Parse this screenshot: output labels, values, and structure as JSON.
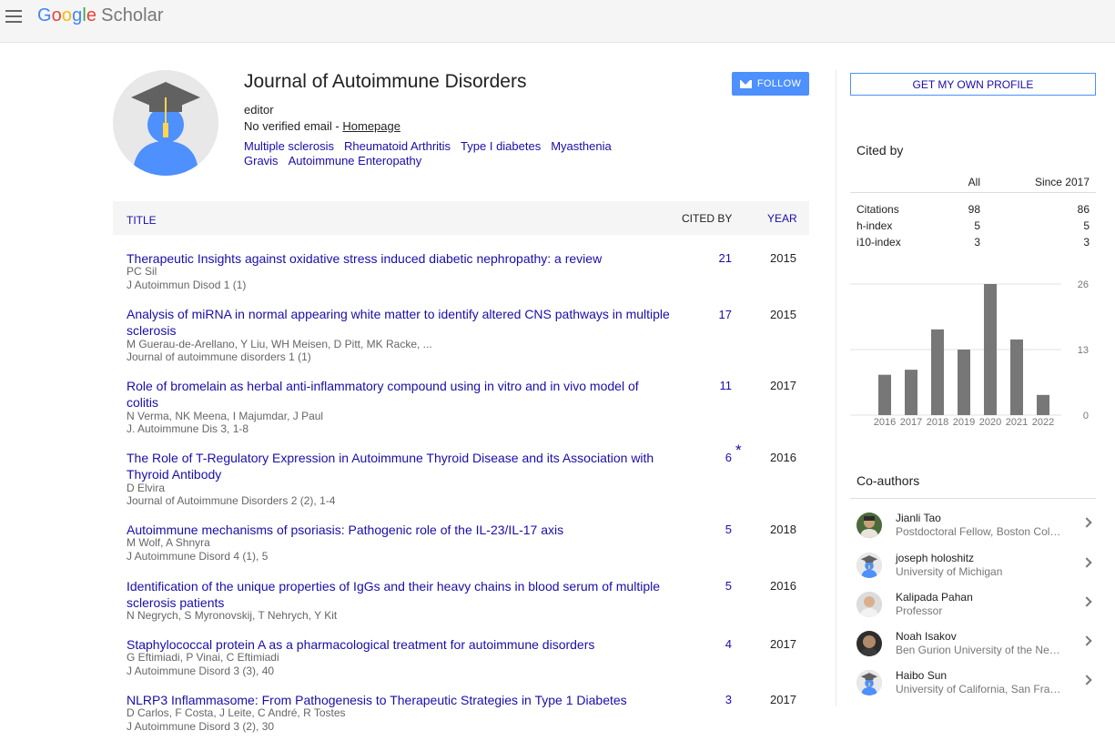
{
  "app": {
    "logo_google": [
      "G",
      "o",
      "o",
      "g",
      "l",
      "e"
    ],
    "logo_scholar": "Scholar"
  },
  "profile": {
    "name": "Journal of Autoimmune Disorders",
    "affiliation": "editor",
    "email_text": "No verified email - ",
    "homepage_label": "Homepage",
    "interests": [
      "Multiple sclerosis",
      "Rheumatoid Arthritis",
      "Type I diabetes",
      "Myasthenia Gravis",
      "Autoimmune Enteropathy"
    ],
    "follow_label": "FOLLOW"
  },
  "table": {
    "headers": {
      "title": "TITLE",
      "cited_by": "CITED BY",
      "year": "YEAR"
    },
    "articles": [
      {
        "title": "Therapeutic Insights against oxidative stress induced diabetic nephropathy: a review",
        "authors": "PC Sil",
        "venue": "J Autoimmun Disod 1 (1)",
        "cited": "21",
        "year": "2015"
      },
      {
        "title": "Analysis of miRNA in normal appearing white matter to identify altered CNS pathways in multiple sclerosis",
        "authors": "M Guerau-de-Arellano, Y Liu, WH Meisen, D Pitt, MK Racke, ...",
        "venue": "Journal of autoimmune disorders 1 (1)",
        "cited": "17",
        "year": "2015"
      },
      {
        "title": "Role of bromelain as herbal anti-inflammatory compound using in vitro and in vivo model of colitis",
        "authors": "N Verma, NK Meena, I Majumdar, J Paul",
        "venue": "J. Autoimmune Dis 3, 1-8",
        "cited": "11",
        "year": "2017"
      },
      {
        "title": "The Role of T-Regulatory Expression in Autoimmune Thyroid Disease and its Association with Thyroid Antibody",
        "authors": "D Elvira",
        "venue": "Journal of Autoimmune Disorders 2 (2), 1-4",
        "cited": "6",
        "star": "*",
        "year": "2016"
      },
      {
        "title": "Autoimmune mechanisms of psoriasis: Pathogenic role of the IL-23/IL-17 axis",
        "authors": "M Wolf, A Shnyra",
        "venue": "J Autoimmune Disord 4 (1), 5",
        "cited": "5",
        "year": "2018"
      },
      {
        "title": "Identification of the unique properties of IgGs and their heavy chains in blood serum of multiple sclerosis patients",
        "authors": "N Negrych, S Myronovskij, T Nehrych, Y Kit",
        "venue": "",
        "cited": "5",
        "year": "2016"
      },
      {
        "title": "Staphylococcal protein A as a pharmacological treatment for autoimmune disorders",
        "authors": "G Eftimiadi, P Vinai, C Eftimiadi",
        "venue": "J Autoimmune Disord 3 (3), 40",
        "cited": "4",
        "year": "2017"
      },
      {
        "title": "NLRP3 Inflammasome: From Pathogenesis to Therapeutic Strategies in Type 1 Diabetes",
        "authors": "D Carlos, F Costa, J Leite, C André, R Tostes",
        "venue": "J Autoimmune Disord 3 (2), 30",
        "cited": "3",
        "year": "2017"
      }
    ]
  },
  "sidebar": {
    "get_profile_label": "GET MY OWN PROFILE",
    "cited_by_title": "Cited by",
    "stats_headers": [
      "",
      "All",
      "Since 2017"
    ],
    "stats": [
      {
        "label": "Citations",
        "all": "98",
        "since": "86"
      },
      {
        "label": "h-index",
        "all": "5",
        "since": "5"
      },
      {
        "label": "i10-index",
        "all": "3",
        "since": "3"
      }
    ],
    "coauthors_title": "Co-authors",
    "coauthors": [
      {
        "name": "Jianli Tao",
        "affil": "Postdoctoral Fellow, Boston College",
        "avatar": "photo"
      },
      {
        "name": "joseph holoshitz",
        "affil": "University of Michigan",
        "avatar": "default"
      },
      {
        "name": "Kalipada Pahan",
        "affil": "Professor",
        "avatar": "photo"
      },
      {
        "name": "Noah Isakov",
        "affil": "Ben Gurion University of the Negev",
        "avatar": "photo"
      },
      {
        "name": "Haibo Sun",
        "affil": "University of California, San Francisco",
        "avatar": "default"
      }
    ]
  },
  "chart_data": {
    "type": "bar",
    "categories": [
      "2016",
      "2017",
      "2018",
      "2019",
      "2020",
      "2021",
      "2022"
    ],
    "values": [
      8,
      9,
      17,
      13,
      26,
      15,
      4
    ],
    "yticks": [
      "26",
      "13",
      "0"
    ],
    "ylim": [
      0,
      26
    ],
    "grid": true,
    "bar_color": "#777777"
  },
  "colors": {
    "link": "#1a0dab",
    "accent": "#4d90fe"
  }
}
